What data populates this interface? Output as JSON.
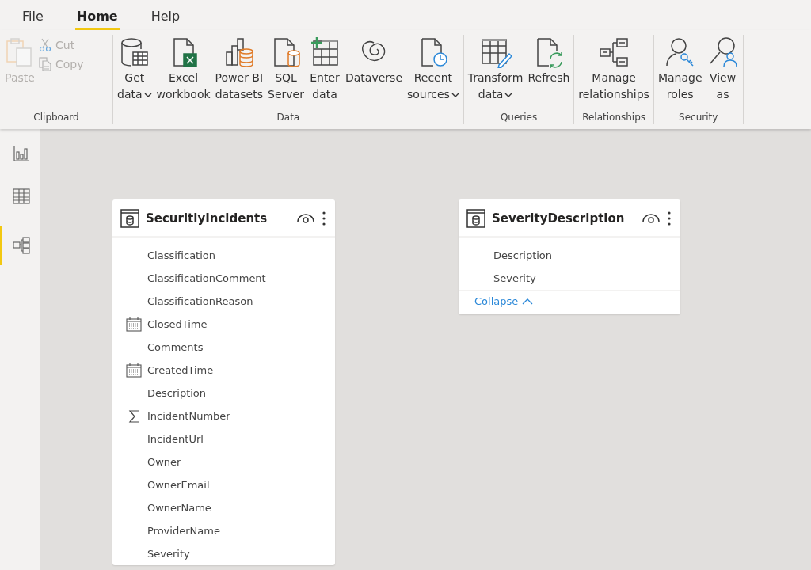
{
  "menu_tabs": [
    {
      "label": "File",
      "selected": false
    },
    {
      "label": "Home",
      "selected": true
    },
    {
      "label": "Help",
      "selected": false
    }
  ],
  "ribbon_groups": [
    {
      "label": "Clipboard",
      "buttons": [
        {
          "kind": "paste",
          "lines": [
            "Paste"
          ],
          "dropdown": false,
          "disabled": true
        }
      ],
      "small_buttons": [
        {
          "kind": "cut",
          "label": "Cut",
          "disabled": true
        },
        {
          "kind": "copy",
          "label": "Copy",
          "disabled": true
        }
      ]
    },
    {
      "label": "Data",
      "buttons": [
        {
          "kind": "get-data",
          "lines": [
            "Get",
            "data"
          ],
          "dropdown": true,
          "disabled": false
        },
        {
          "kind": "excel",
          "lines": [
            "Excel",
            "workbook"
          ],
          "dropdown": false,
          "disabled": false
        },
        {
          "kind": "datasets",
          "lines": [
            "Power BI",
            "datasets"
          ],
          "dropdown": false,
          "disabled": false
        },
        {
          "kind": "sql",
          "lines": [
            "SQL",
            "Server"
          ],
          "dropdown": false,
          "disabled": false
        },
        {
          "kind": "enter-data",
          "lines": [
            "Enter",
            "data"
          ],
          "dropdown": false,
          "disabled": false
        },
        {
          "kind": "dataverse",
          "lines": [
            "Dataverse"
          ],
          "dropdown": false,
          "disabled": false
        },
        {
          "kind": "recent",
          "lines": [
            "Recent",
            "sources"
          ],
          "dropdown": true,
          "disabled": false
        }
      ]
    },
    {
      "label": "Queries",
      "buttons": [
        {
          "kind": "transform",
          "lines": [
            "Transform",
            "data"
          ],
          "dropdown": true,
          "disabled": false
        },
        {
          "kind": "refresh",
          "lines": [
            "Refresh"
          ],
          "dropdown": false,
          "disabled": false
        }
      ]
    },
    {
      "label": "Relationships",
      "buttons": [
        {
          "kind": "relationships",
          "lines": [
            "Manage",
            "relationships"
          ],
          "dropdown": false,
          "disabled": false
        }
      ]
    },
    {
      "label": "Security",
      "buttons": [
        {
          "kind": "roles",
          "lines": [
            "Manage",
            "roles"
          ],
          "dropdown": false,
          "disabled": false
        },
        {
          "kind": "view-as",
          "lines": [
            "View",
            "as"
          ],
          "dropdown": false,
          "disabled": false
        }
      ]
    }
  ],
  "views": [
    {
      "kind": "report",
      "selected": false
    },
    {
      "kind": "data",
      "selected": false
    },
    {
      "kind": "model",
      "selected": true
    }
  ],
  "tables": [
    {
      "title": "SecuritiyIncidents",
      "fields": [
        {
          "name": "Classification",
          "kind": "text"
        },
        {
          "name": "ClassificationComment",
          "kind": "text"
        },
        {
          "name": "ClassificationReason",
          "kind": "text"
        },
        {
          "name": "ClosedTime",
          "kind": "date"
        },
        {
          "name": "Comments",
          "kind": "text"
        },
        {
          "name": "CreatedTime",
          "kind": "date"
        },
        {
          "name": "Description",
          "kind": "text"
        },
        {
          "name": "IncidentNumber",
          "kind": "number"
        },
        {
          "name": "IncidentUrl",
          "kind": "text"
        },
        {
          "name": "Owner",
          "kind": "text"
        },
        {
          "name": "OwnerEmail",
          "kind": "text"
        },
        {
          "name": "OwnerName",
          "kind": "text"
        },
        {
          "name": "ProviderName",
          "kind": "text"
        },
        {
          "name": "Severity",
          "kind": "text"
        }
      ]
    },
    {
      "title": "SeverityDescription",
      "fields": [
        {
          "name": "Description",
          "kind": "text"
        },
        {
          "name": "Severity",
          "kind": "text"
        }
      ],
      "footer": "Collapse"
    }
  ]
}
